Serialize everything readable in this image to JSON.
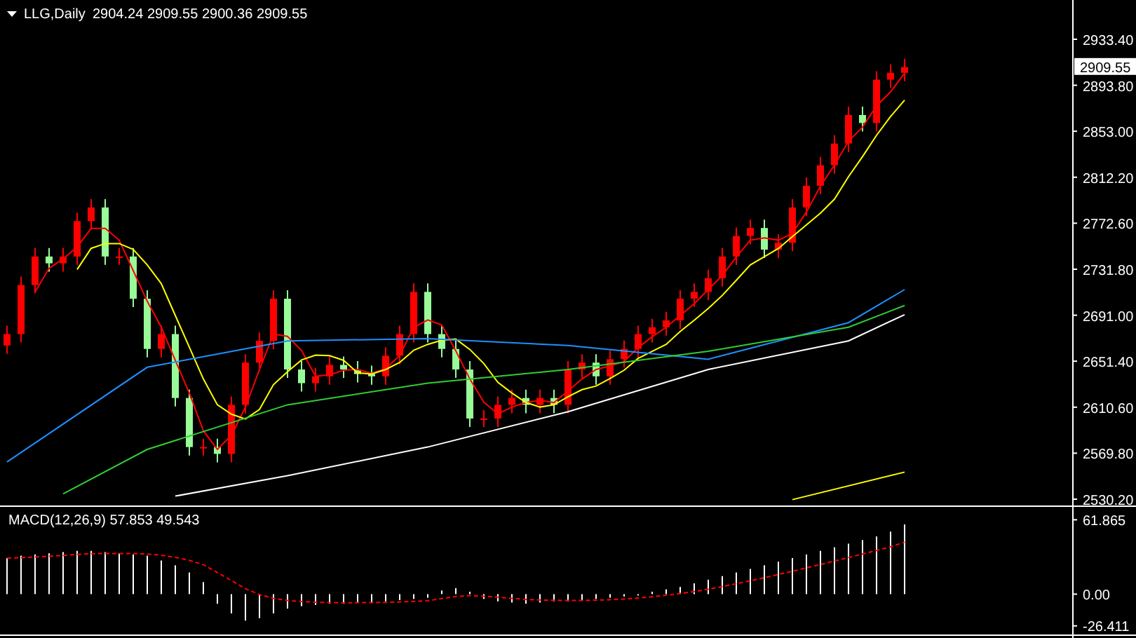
{
  "header": {
    "symbol": "LLG,Daily",
    "ohlc": [
      "2904.24",
      "2909.55",
      "2900.36",
      "2909.55"
    ]
  },
  "price_axis": {
    "labels": [
      "2933.40",
      "2893.80",
      "2853.00",
      "2812.20",
      "2772.60",
      "2731.80",
      "2691.00",
      "2651.40",
      "2610.60",
      "2569.80",
      "2530.20"
    ],
    "current_price": "2909.55"
  },
  "macd": {
    "label": "MACD(12,26,9) 57.853 49.543",
    "axis_labels": [
      "61.865",
      "0.00",
      "-26.411"
    ]
  }
}
